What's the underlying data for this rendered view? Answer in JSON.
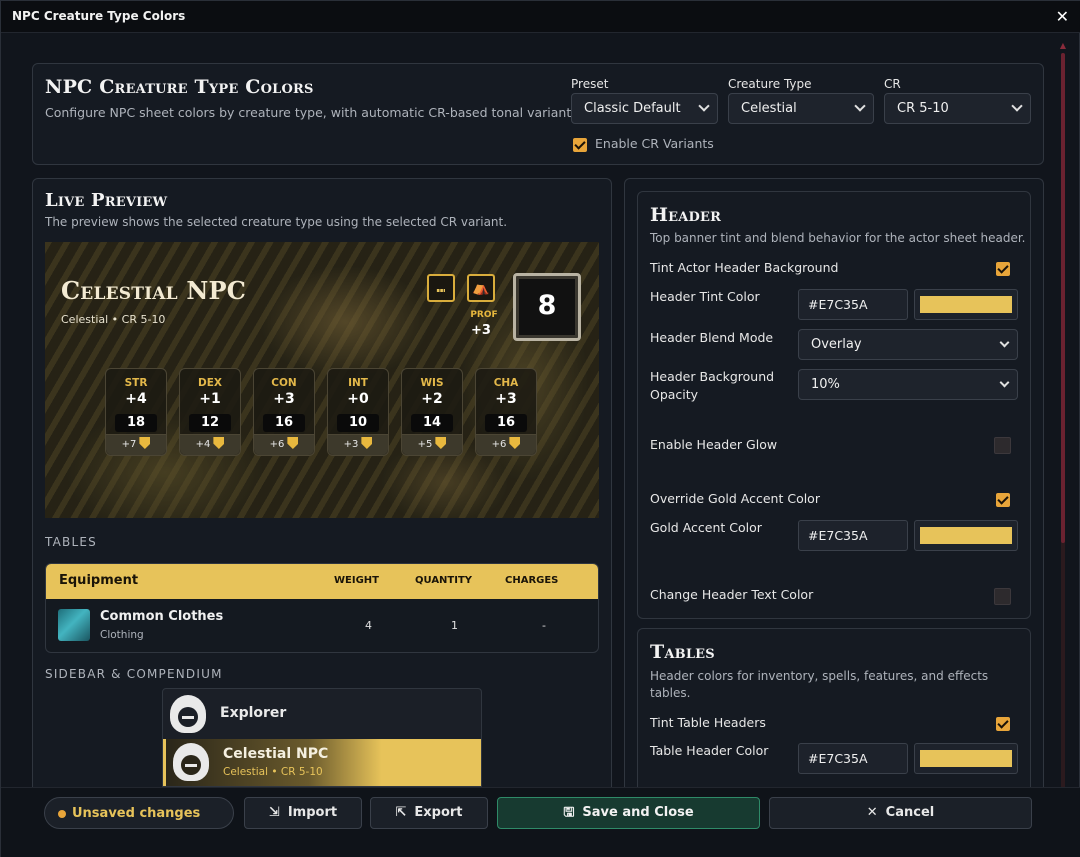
{
  "window": {
    "title": "NPC Creature Type Colors",
    "close_glyph": "✕"
  },
  "top": {
    "title": "NPC Creature Type Colors",
    "subtitle": "Configure NPC sheet colors by creature type, with automatic CR-based tonal variants.",
    "preset": {
      "label": "Preset",
      "value": "Classic Default"
    },
    "creature_type": {
      "label": "Creature Type",
      "value": "Celestial"
    },
    "cr": {
      "label": "CR",
      "value": "CR 5-10"
    },
    "enable_cr_variants": {
      "label": "Enable CR Variants",
      "checked": true
    }
  },
  "preview": {
    "title": "Live Preview",
    "subtitle": "The preview shows the selected creature type using the selected CR variant.",
    "npc_name": "Celestial NPC",
    "npc_sub": "Celestial • CR 5-10",
    "prof_label": "PROF",
    "prof_value": "+3",
    "ac_value": "8",
    "stats": [
      {
        "ab": "STR",
        "mod": "+4",
        "score": "18",
        "save": "+7"
      },
      {
        "ab": "DEX",
        "mod": "+1",
        "score": "12",
        "save": "+4"
      },
      {
        "ab": "CON",
        "mod": "+3",
        "score": "16",
        "save": "+6"
      },
      {
        "ab": "INT",
        "mod": "+0",
        "score": "10",
        "save": "+3"
      },
      {
        "ab": "WIS",
        "mod": "+2",
        "score": "14",
        "save": "+5"
      },
      {
        "ab": "CHA",
        "mod": "+3",
        "score": "16",
        "save": "+6"
      }
    ],
    "tables_label": "TABLES",
    "table": {
      "name": "Equipment",
      "col_weight": "WEIGHT",
      "col_quantity": "QUANTITY",
      "col_charges": "CHARGES",
      "row": {
        "name": "Common Clothes",
        "type": "Clothing",
        "weight": "4",
        "quantity": "1",
        "charges": "-"
      }
    },
    "sidebar_label": "SIDEBAR & COMPENDIUM",
    "sidebar_items": [
      {
        "name": "Explorer"
      },
      {
        "name": "Celestial NPC",
        "sub": "Celestial • CR 5-10"
      }
    ]
  },
  "header_section": {
    "title": "Header",
    "subtitle": "Top banner tint and blend behavior for the actor sheet header.",
    "tint_bg": {
      "label": "Tint Actor Header Background",
      "checked": true
    },
    "tint_color": {
      "label": "Header Tint Color",
      "value": "#E7C35A"
    },
    "blend_mode": {
      "label": "Header Blend Mode",
      "value": "Overlay"
    },
    "bg_opacity": {
      "label": "Header Background Opacity",
      "value": "10%"
    },
    "glow": {
      "label": "Enable Header Glow",
      "checked": false
    },
    "override_gold": {
      "label": "Override Gold Accent Color",
      "checked": true
    },
    "gold_color": {
      "label": "Gold Accent Color",
      "value": "#E7C35A"
    },
    "text_color": {
      "label": "Change Header Text Color",
      "checked": false
    }
  },
  "tables_section": {
    "title": "Tables",
    "subtitle": "Header colors for inventory, spells, features, and effects tables.",
    "tint_headers": {
      "label": "Tint Table Headers",
      "checked": true
    },
    "header_color": {
      "label": "Table Header Color",
      "value": "#E7C35A"
    }
  },
  "footer": {
    "unsaved": "Unsaved changes",
    "import": "Import",
    "export": "Export",
    "save": "Save and Close",
    "cancel": "Cancel"
  },
  "colors": {
    "gold": "#e7c35a",
    "accent_orange": "#e8a53a",
    "save_green": "#1f4a3c"
  }
}
